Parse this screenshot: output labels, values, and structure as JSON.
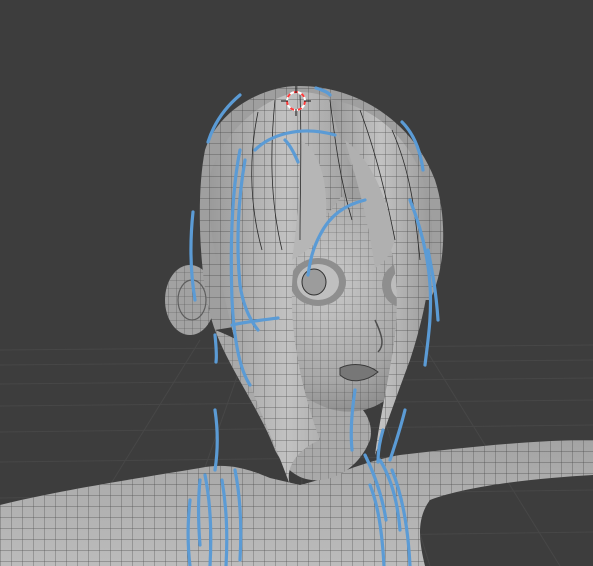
{
  "viewport": {
    "background_color": "#3d3d3d",
    "floor_grid_color": "#474747",
    "mesh_base_color": "#b9b9b9",
    "mesh_shadow_color": "#8e8e8e",
    "wireframe_color": "#1c1c1c",
    "guide_curve_color": "#5b9bd5",
    "cursor_color": "#ff3b3b"
  },
  "objects": {
    "mesh": "character-head-mesh",
    "guides": "hair-guide-curves",
    "cursor": "3d-cursor-icon"
  }
}
